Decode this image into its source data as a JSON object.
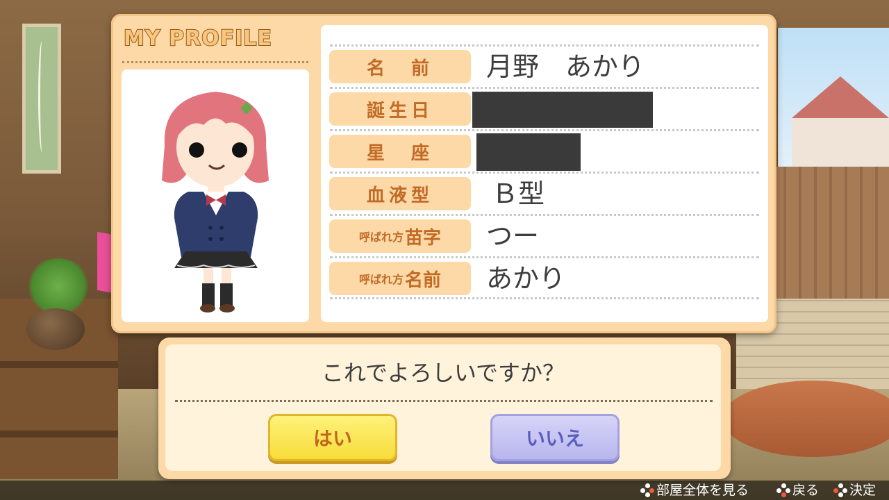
{
  "profile": {
    "title": "MY PROFILE",
    "rows": [
      {
        "label": "名　前",
        "value": "月野　あかり"
      },
      {
        "label": "誕生日",
        "value": ""
      },
      {
        "label": "星　座",
        "value": ""
      },
      {
        "label": "血液型",
        "value": "Ｂ型"
      },
      {
        "label_small": "呼ばれ方",
        "label_big": "苗字",
        "value": "つー"
      },
      {
        "label_small": "呼ばれ方",
        "label_big": "名前",
        "value": "あかり"
      }
    ]
  },
  "confirm": {
    "question": "これでよろしいですか？",
    "yes_label": "はい",
    "no_label": "いいえ"
  },
  "footer": {
    "view_room": "部屋全体を見る",
    "back": "戻る",
    "decide": "決定"
  },
  "colors": {
    "panel": "#fcd9a7",
    "label_text": "#c26a26",
    "yes_button": "#f7dc3a",
    "no_button": "#b8b6ee"
  },
  "icons": [
    "dpad-right-icon",
    "dpad-down-icon",
    "dpad-left-icon"
  ]
}
